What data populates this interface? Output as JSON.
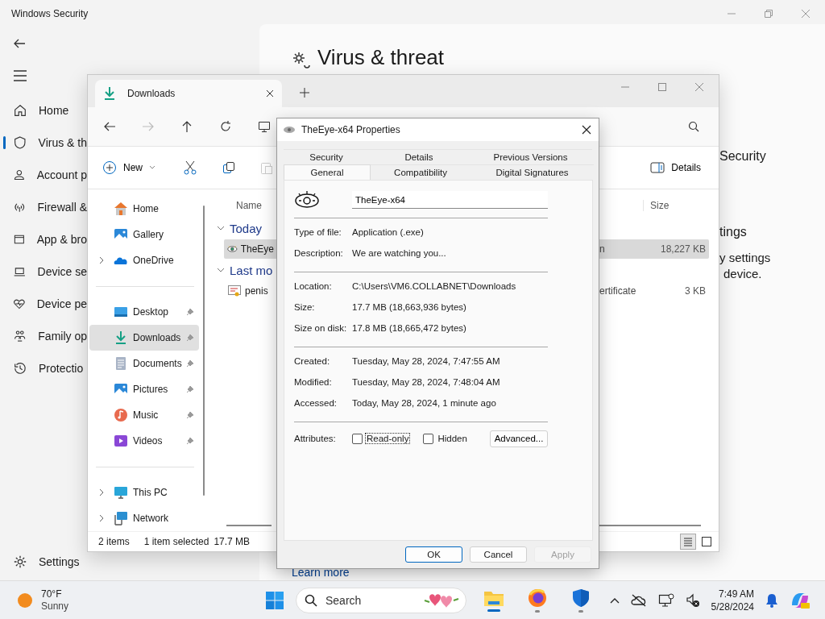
{
  "security_window": {
    "title": "Windows Security",
    "nav": [
      {
        "label": "Home",
        "kind": "home",
        "selected": false
      },
      {
        "label": "Virus & th",
        "kind": "shield",
        "selected": true
      },
      {
        "label": "Account p",
        "kind": "person",
        "selected": false
      },
      {
        "label": "Firewall &",
        "kind": "antenna",
        "selected": false
      },
      {
        "label": "App & bro",
        "kind": "window",
        "selected": false
      },
      {
        "label": "Device se",
        "kind": "laptop",
        "selected": false
      },
      {
        "label": "Device pe",
        "kind": "heart",
        "selected": false
      },
      {
        "label": "Family op",
        "kind": "family",
        "selected": false
      },
      {
        "label": "Protectio",
        "kind": "history",
        "selected": false
      }
    ],
    "settings": "Settings",
    "heading": "Virus & threat",
    "fragments": [
      "Security",
      "tings",
      "y settings",
      "device."
    ],
    "link": "Learn more"
  },
  "explorer": {
    "tab": "Downloads",
    "new_button": "New",
    "details_button": "Details",
    "nav_sections": [
      {
        "items": [
          {
            "label": "Home",
            "kind": "home",
            "expandable": false,
            "pinned": false,
            "selected": false
          },
          {
            "label": "Gallery",
            "kind": "gallery",
            "expandable": false,
            "pinned": false,
            "selected": false
          },
          {
            "label": "OneDrive",
            "kind": "cloud",
            "expandable": true,
            "pinned": false,
            "selected": false
          }
        ]
      },
      {
        "items": [
          {
            "label": "Desktop",
            "kind": "desktop",
            "expandable": false,
            "pinned": true,
            "selected": false
          },
          {
            "label": "Downloads",
            "kind": "download",
            "expandable": false,
            "pinned": true,
            "selected": true
          },
          {
            "label": "Documents",
            "kind": "document",
            "expandable": false,
            "pinned": true,
            "selected": false
          },
          {
            "label": "Pictures",
            "kind": "pictures",
            "expandable": false,
            "pinned": true,
            "selected": false
          },
          {
            "label": "Music",
            "kind": "music",
            "expandable": false,
            "pinned": true,
            "selected": false
          },
          {
            "label": "Videos",
            "kind": "videos",
            "expandable": false,
            "pinned": true,
            "selected": false
          }
        ]
      },
      {
        "items": [
          {
            "label": "This PC",
            "kind": "pc",
            "expandable": true,
            "pinned": false,
            "selected": false
          },
          {
            "label": "Network",
            "kind": "network",
            "expandable": true,
            "pinned": false,
            "selected": false
          }
        ]
      }
    ],
    "columns": {
      "name": "Name",
      "size": "Size"
    },
    "groups": [
      {
        "label": "Today",
        "expanded": true,
        "files": [
          {
            "name": "TheEye",
            "kind": "exe",
            "type": "n",
            "size": "18,227 KB",
            "selected": true
          }
        ]
      },
      {
        "label": "Last mo",
        "expanded": true,
        "files": [
          {
            "name": "penis",
            "kind": "certificate",
            "type": "ertificate",
            "size": "3 KB",
            "selected": false
          }
        ]
      }
    ],
    "status": {
      "count": "2 items",
      "selection": "1 item selected",
      "size": "17.7 MB"
    }
  },
  "dialog": {
    "title": "TheEye-x64 Properties",
    "tab_rows": [
      [
        {
          "label": "Security",
          "selected": false
        },
        {
          "label": "Details",
          "selected": false
        },
        {
          "label": "Previous Versions",
          "selected": false
        }
      ],
      [
        {
          "label": "General",
          "selected": true
        },
        {
          "label": "Compatibility",
          "selected": false
        },
        {
          "label": "Digital Signatures",
          "selected": false
        }
      ]
    ],
    "name_field": "TheEye-x64",
    "sections": [
      [
        {
          "label": "Type of file:",
          "value": "Application (.exe)"
        },
        {
          "label": "Description:",
          "value": "We are watching you..."
        }
      ],
      [
        {
          "label": "Location:",
          "value": "C:\\Users\\VM6.COLLABNET\\Downloads"
        },
        {
          "label": "Size:",
          "value": "17.7 MB (18,663,936 bytes)"
        },
        {
          "label": "Size on disk:",
          "value": "17.8 MB (18,665,472 bytes)"
        }
      ],
      [
        {
          "label": "Created:",
          "value": "Tuesday, May 28, 2024, 7:47:55 AM"
        },
        {
          "label": "Modified:",
          "value": "Tuesday, May 28, 2024, 7:48:04 AM"
        },
        {
          "label": "Accessed:",
          "value": "Today, May 28, 2024, 1 minute ago"
        }
      ]
    ],
    "attributes": {
      "label": "Attributes:",
      "options": [
        {
          "label": "Read-only",
          "checked": false,
          "focused": true
        },
        {
          "label": "Hidden",
          "checked": false,
          "focused": false
        }
      ],
      "advanced": "Advanced..."
    },
    "buttons": [
      {
        "label": "OK",
        "default": true,
        "disabled": false
      },
      {
        "label": "Cancel",
        "default": false,
        "disabled": false
      },
      {
        "label": "Apply",
        "default": false,
        "disabled": true
      }
    ]
  },
  "taskbar": {
    "weather": {
      "temperature": "70°F",
      "condition": "Sunny"
    },
    "search_placeholder": "Search",
    "apps": [
      {
        "kind": "explorer",
        "active": true
      },
      {
        "kind": "firefox",
        "active": false
      },
      {
        "kind": "defender",
        "active": false
      }
    ],
    "clock": {
      "time": "7:49 AM",
      "date": "5/28/2024"
    }
  }
}
